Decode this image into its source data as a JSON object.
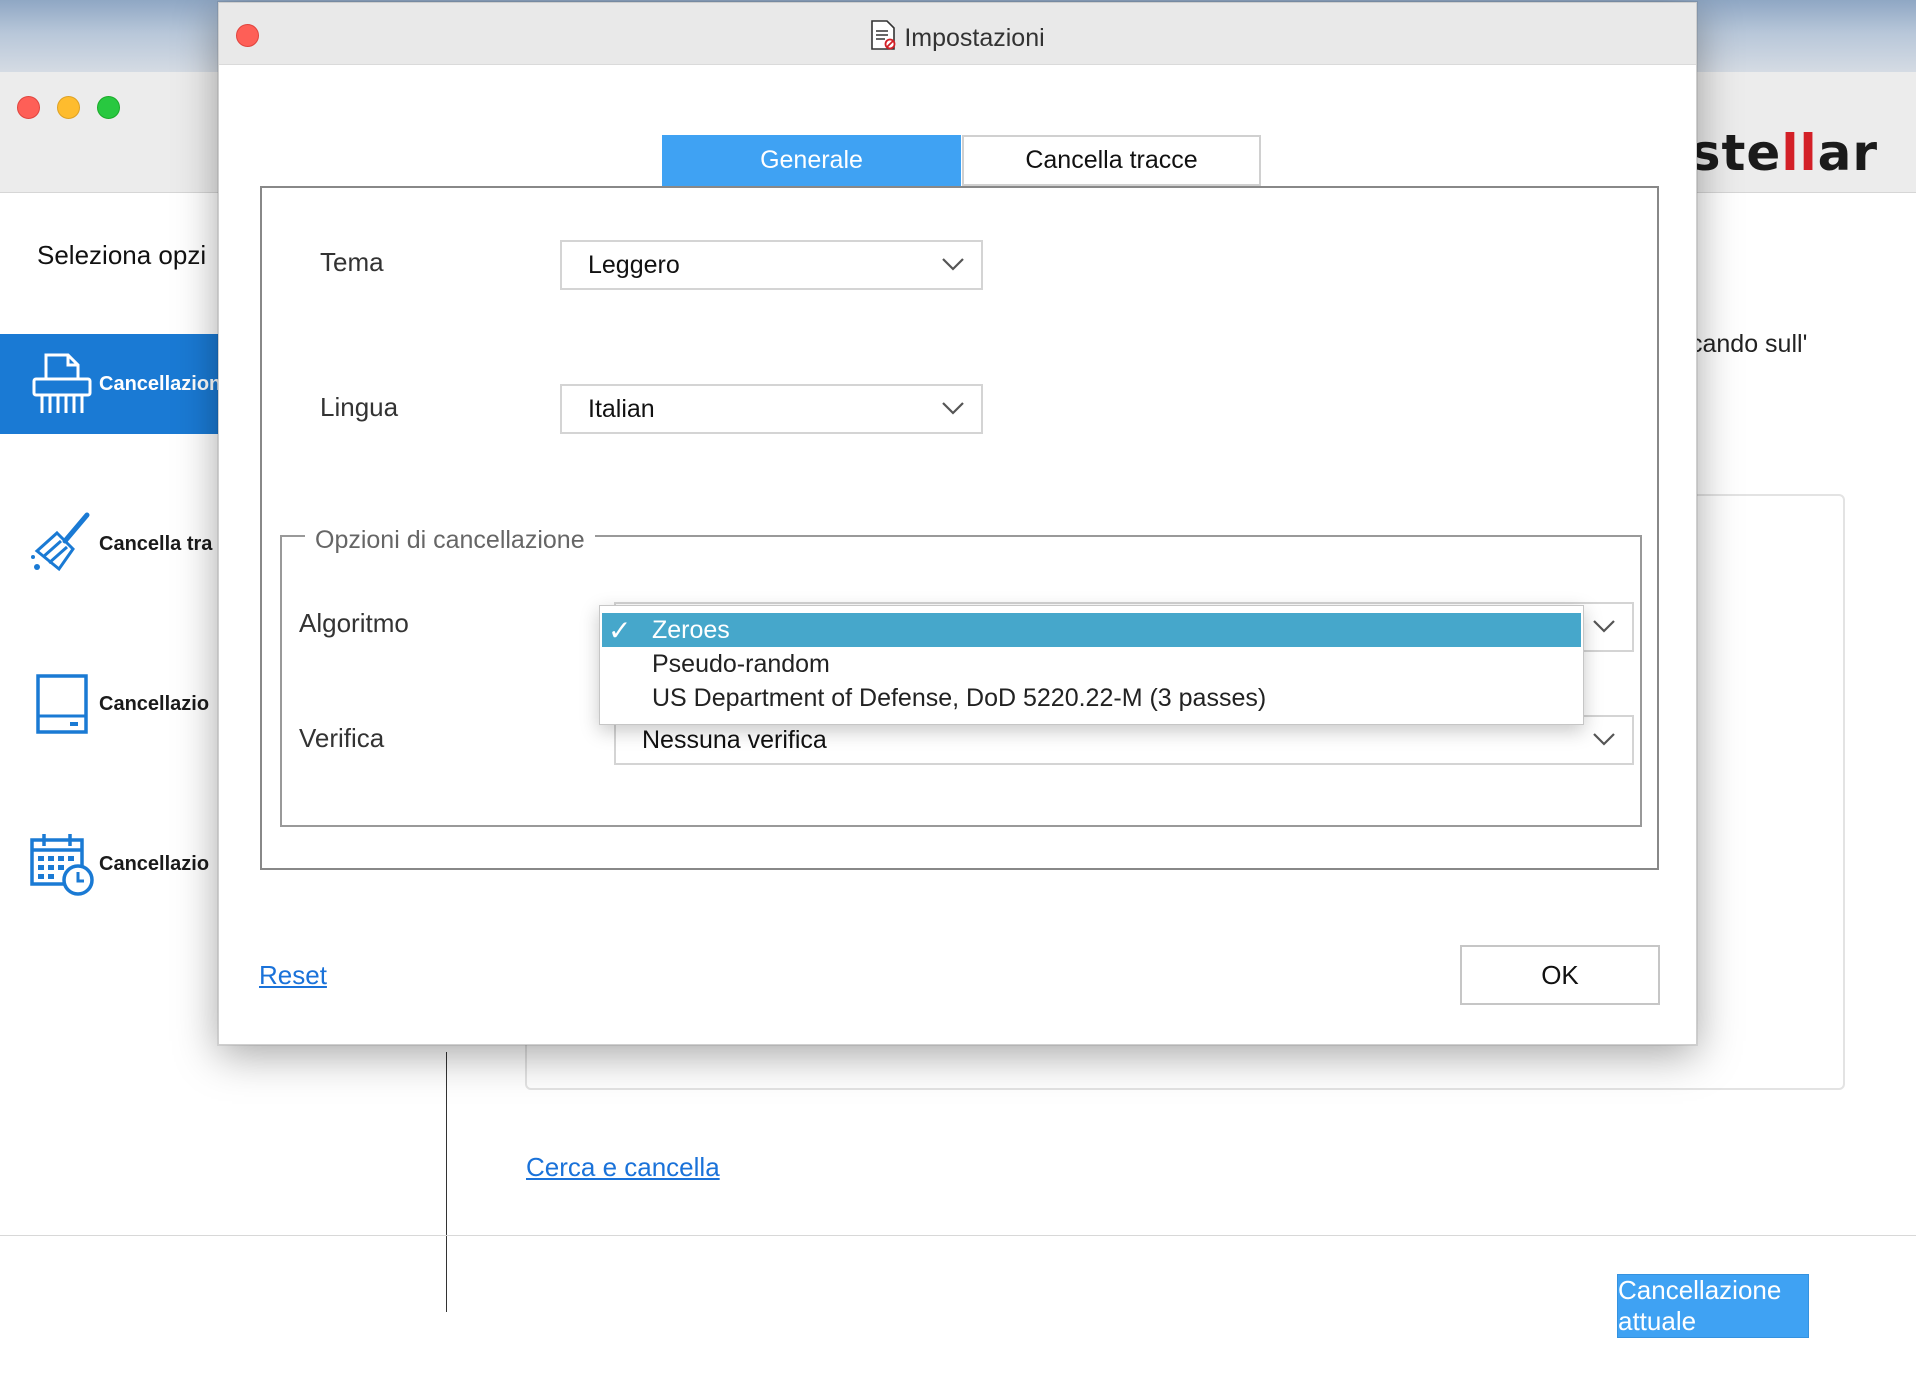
{
  "app": {
    "brand": {
      "prefix": "ste",
      "mark": "ll",
      "suffix": "ar"
    },
    "select_title": "Seleziona opzi",
    "sidebar": [
      {
        "label": "Cancellazion",
        "icon": "shredder-icon",
        "active": true
      },
      {
        "label": "Cancella tra",
        "icon": "broom-icon",
        "active": false
      },
      {
        "label": "Cancellazio",
        "icon": "drive-icon",
        "active": false
      },
      {
        "label": "Cancellazio",
        "icon": "calendar-clock-icon",
        "active": false
      }
    ],
    "hint_text": "cando sull'",
    "search_link": "Cerca e cancella",
    "primary_button": "Cancellazione attuale"
  },
  "dialog": {
    "title": "Impostazioni",
    "tabs": [
      {
        "label": "Generale",
        "active": true
      },
      {
        "label": "Cancella tracce",
        "active": false
      }
    ],
    "theme": {
      "label": "Tema",
      "value": "Leggero"
    },
    "language": {
      "label": "Lingua",
      "value": "Italian"
    },
    "erase_options": {
      "legend": "Opzioni di cancellazione",
      "algorithm": {
        "label": "Algoritmo",
        "options": [
          "Zeroes",
          "Pseudo-random",
          "US Department of Defense, DoD 5220.22-M (3 passes)"
        ],
        "selected": "Zeroes"
      },
      "verification": {
        "label": "Verifica",
        "value": "Nessuna verifica"
      }
    },
    "reset": "Reset",
    "ok": "OK"
  },
  "colors": {
    "accent": "#3fa2f3",
    "sidebar_active": "#1a7ad4",
    "selection": "#46a7cb",
    "link": "#1a72d9",
    "brand_mark": "#d32027"
  }
}
